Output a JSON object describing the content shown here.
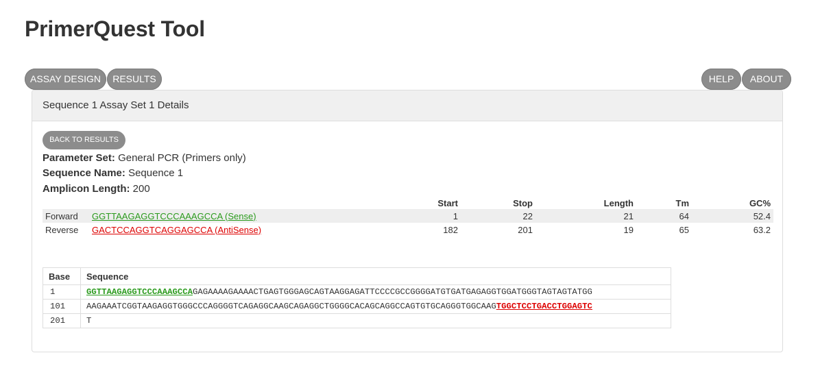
{
  "app": {
    "title": "PrimerQuest Tool"
  },
  "nav": {
    "assay_design": "ASSAY DESIGN",
    "results": "RESULTS",
    "help": "HELP",
    "about": "ABOUT"
  },
  "panel": {
    "heading": "Sequence 1 Assay Set 1 Details",
    "back_button": "BACK TO RESULTS"
  },
  "details": {
    "parameter_set_label": "Parameter Set:",
    "parameter_set_value": "General PCR (Primers only)",
    "sequence_name_label": "Sequence Name:",
    "sequence_name_value": "Sequence 1",
    "amplicon_length_label": "Amplicon Length:",
    "amplicon_length_value": "200"
  },
  "primer_table": {
    "headers": {
      "start": "Start",
      "stop": "Stop",
      "length": "Length",
      "tm": "Tm",
      "gc": "GC%"
    },
    "rows": [
      {
        "type": "Forward",
        "sequence": "GGTTAAGAGGTCCCAAAGCCA (Sense)",
        "start": "1",
        "stop": "22",
        "length": "21",
        "tm": "64",
        "gc": "52.4"
      },
      {
        "type": "Reverse",
        "sequence": "GACTCCAGGTCAGGAGCCA (AntiSense)",
        "start": "182",
        "stop": "201",
        "length": "19",
        "tm": "65",
        "gc": "63.2"
      }
    ]
  },
  "sequence_table": {
    "headers": {
      "base": "Base",
      "sequence": "Sequence"
    },
    "rows": [
      {
        "base": "1",
        "highlight_pre": "GGTTAAGAGGTCCCAAAGCCA",
        "plain": "GAGAAAAGAAAACTGAGTGGGAGCAGTAAGGAGATTCCCCGCCGGGGATGTGATGAGAGGTGGATGGGTAGTAGTATGG",
        "highlight_post": ""
      },
      {
        "base": "101",
        "highlight_pre": "",
        "plain": "AAGAAATCGGTAAGAGGTGGGCCCAGGGGTCAGAGGCAAGCAGAGGCTGGGGCACAGCAGGCCAGTGTGCAGGGTGGCAAG",
        "highlight_post": "TGGCTCCTGACCTGGAGTC"
      },
      {
        "base": "201",
        "highlight_pre": "",
        "plain": "T",
        "highlight_post": ""
      }
    ]
  },
  "colors": {
    "sense": "#2a9a1c",
    "antisense": "#dd0000",
    "button": "#8c8c8c"
  }
}
